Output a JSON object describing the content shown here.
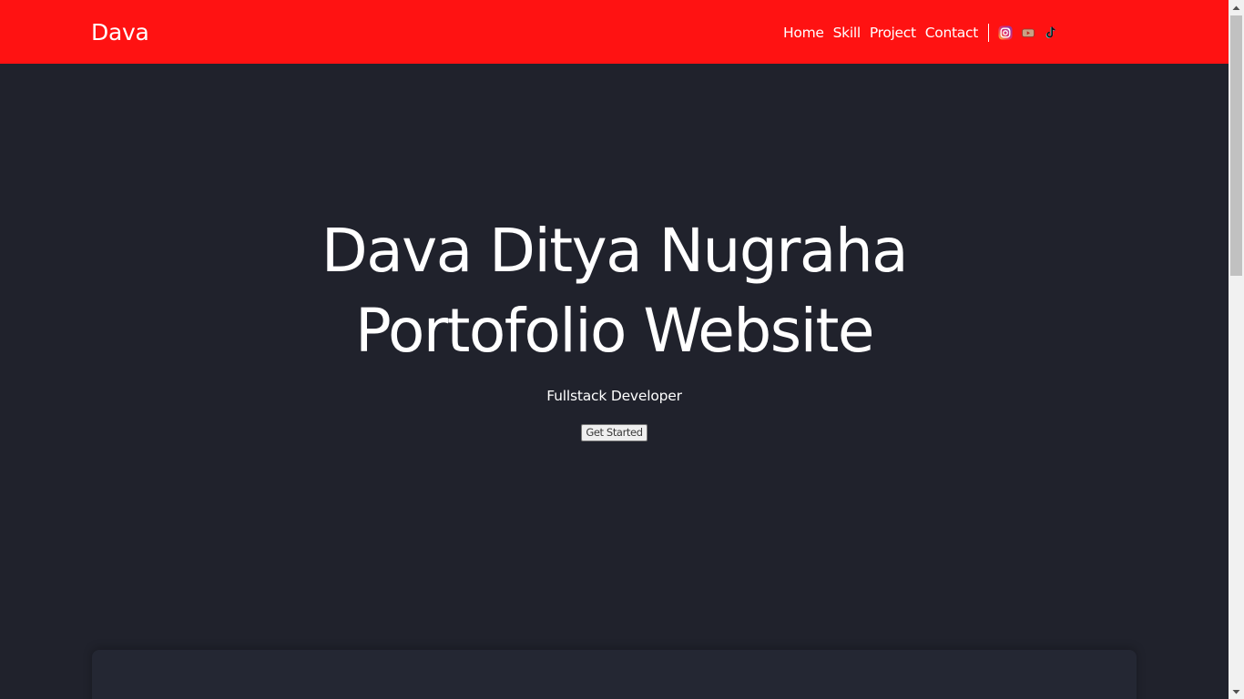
{
  "navbar": {
    "brand": "Dava",
    "links": [
      "Home",
      "Skill",
      "Project",
      "Contact"
    ],
    "social": [
      "instagram-icon",
      "youtube-icon",
      "tiktok-icon"
    ],
    "colors": {
      "background": "#ff1212",
      "text": "#ffffff"
    }
  },
  "hero": {
    "title_line1": "Dava Ditya Nugraha",
    "title_line2": "Portofolio Website",
    "subtitle": "Fullstack Developer",
    "cta_label": "Get Started",
    "colors": {
      "background": "#20222c",
      "text": "#ffffff"
    }
  },
  "next_section": {
    "colors": {
      "background": "#242733"
    }
  }
}
